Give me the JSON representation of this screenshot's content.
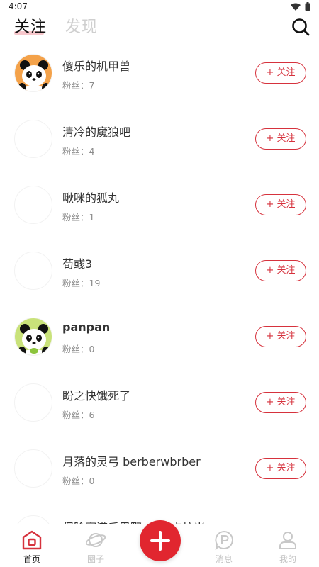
{
  "status_bar": {
    "time": "4:07"
  },
  "header": {
    "tabs": [
      {
        "label": "关注",
        "active": true
      },
      {
        "label": "发现",
        "active": false
      }
    ]
  },
  "follow_label": "+ 关注",
  "users": [
    {
      "name": "傻乐的机甲兽",
      "fans": "粉丝：7",
      "avatar": "panda-orange"
    },
    {
      "name": "清冷的魔狼吧",
      "fans": "粉丝：4",
      "avatar": "blank"
    },
    {
      "name": "啾咪的狐丸",
      "fans": "粉丝：1",
      "avatar": "blank"
    },
    {
      "name": "荀彧3",
      "fans": "粉丝：19",
      "avatar": "blank"
    },
    {
      "name": "panpan",
      "fans": "粉丝：0",
      "avatar": "panda-green"
    },
    {
      "name": "盼之快饿死了",
      "fans": "粉丝：6",
      "avatar": "blank"
    },
    {
      "name": "月落的灵弓 berberwbrber",
      "fans": "粉丝：0",
      "avatar": "blank"
    },
    {
      "name": "保险赛满后思野 ... 心卡拉米",
      "fans": "",
      "avatar": "blank"
    }
  ],
  "bottom_nav": {
    "items": [
      {
        "label": "首页",
        "icon": "home-icon",
        "active": true
      },
      {
        "label": "圈子",
        "icon": "planet-icon",
        "active": false
      },
      {
        "label": "消息",
        "icon": "message-icon",
        "active": false
      },
      {
        "label": "我的",
        "icon": "profile-icon",
        "active": false
      }
    ]
  },
  "colors": {
    "accent": "#d6323d",
    "fab": "#e1262f",
    "tab_underline": "#f7c7cc"
  }
}
